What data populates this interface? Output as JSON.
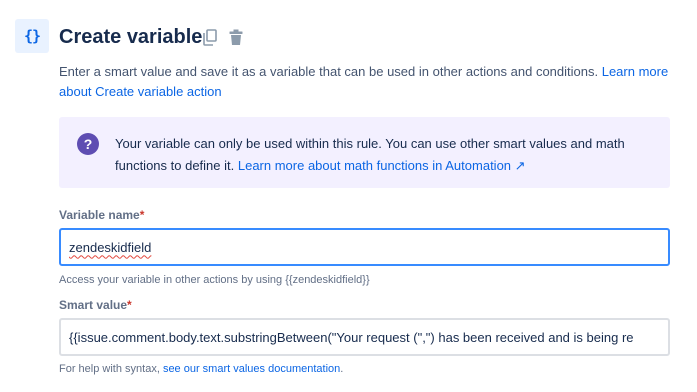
{
  "header": {
    "icon": "curly-braces-icon",
    "icon_glyph": "{}",
    "title": "Create variable",
    "actions": [
      {
        "name": "copy-icon"
      },
      {
        "name": "trash-icon"
      }
    ]
  },
  "description": {
    "text": "Enter a smart value and save it as a variable that can be used in other actions and conditions. ",
    "link": "Learn more about Create variable action"
  },
  "info_panel": {
    "icon": "question-icon",
    "icon_glyph": "?",
    "text": "Your variable can only be used within this rule. You can use other smart values and math functions to define it. ",
    "link": "Learn more about math functions in Automation ↗"
  },
  "variable_name": {
    "label": "Variable name",
    "required_mark": "*",
    "value": "zendeskidfield",
    "helper": "Access your variable in other actions by using {{zendeskidfield}}"
  },
  "smart_value": {
    "label": "Smart value",
    "required_mark": "*",
    "value": "{{issue.comment.body.text.substringBetween(\"Your request (\",\") has been received and is being re",
    "helper_text": "For help with syntax, ",
    "helper_link": "see our smart values documentation",
    "helper_end": "."
  },
  "colors": {
    "accent": "#0c66e4",
    "info_bg": "#f3f0ff",
    "info_icon": "#5e4db2",
    "focus_border": "#388bff",
    "required": "#c9372c"
  }
}
